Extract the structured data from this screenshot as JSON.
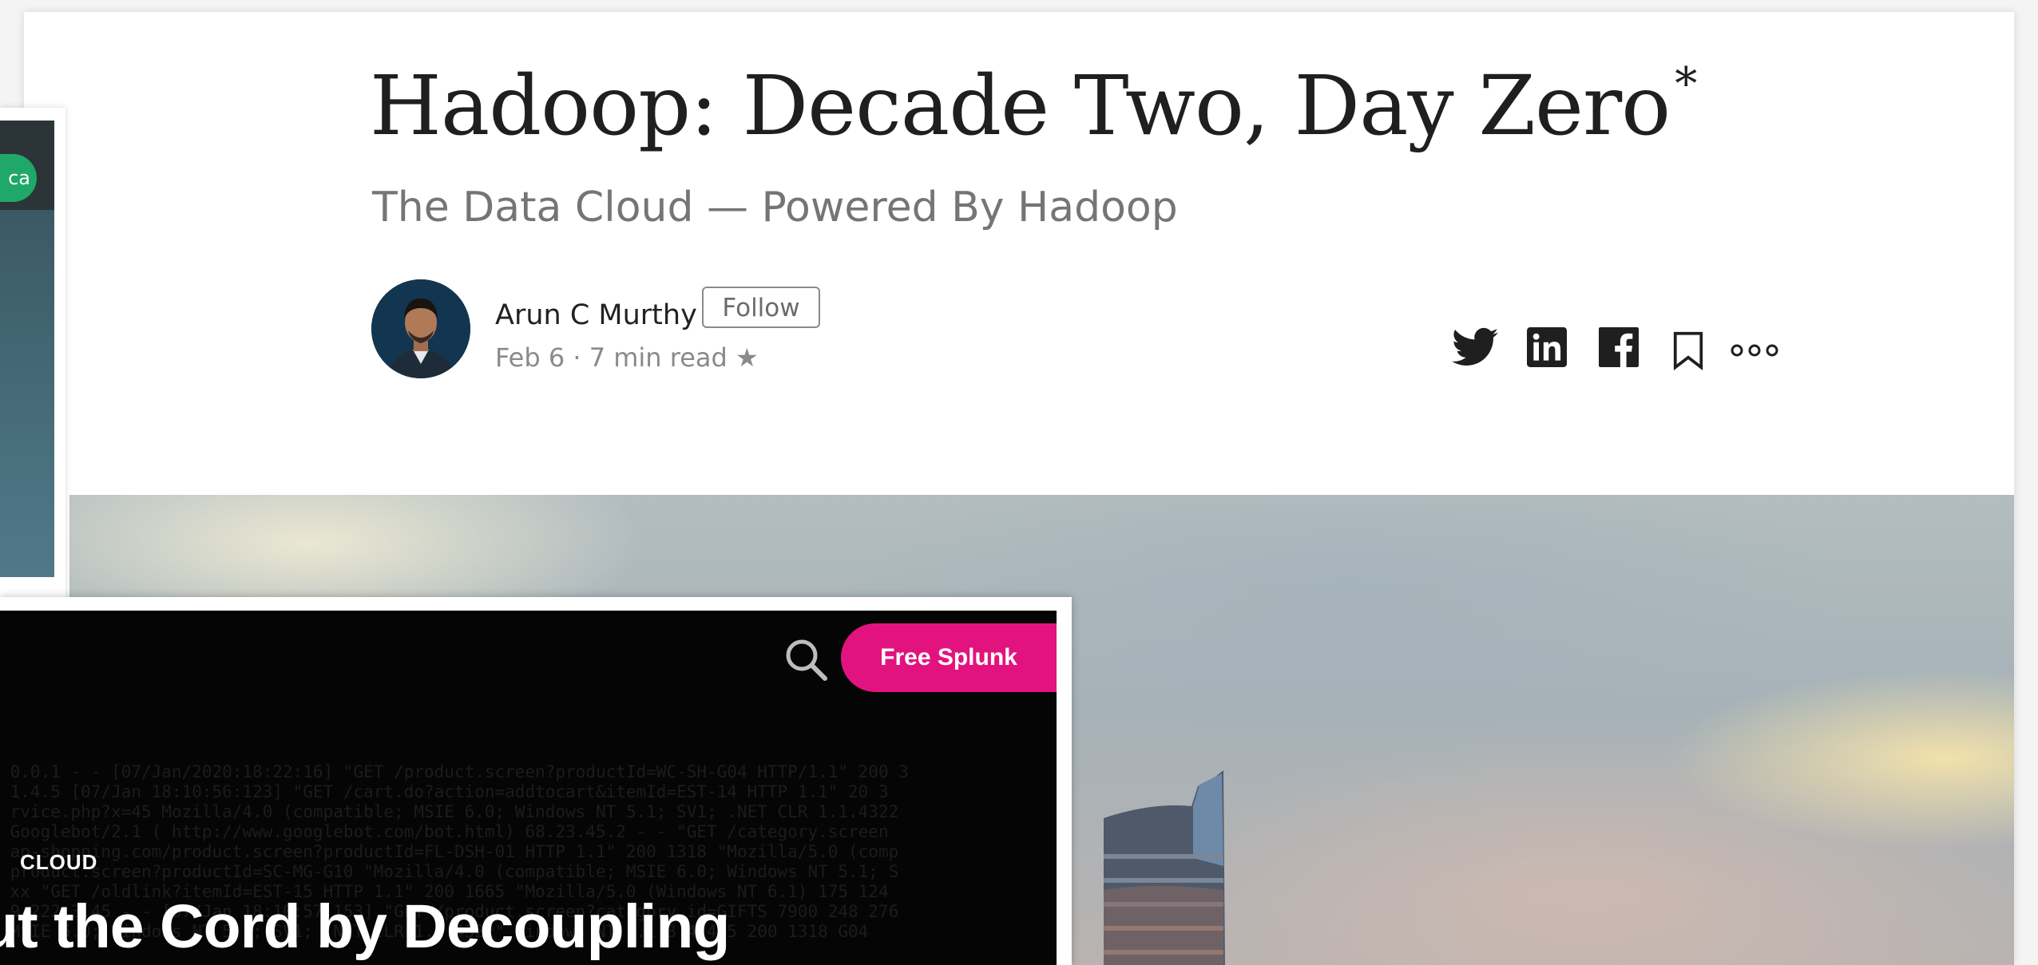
{
  "article": {
    "title": "Hadoop: Decade Two, Day Zero",
    "title_mark": "*",
    "subtitle": "The Data Cloud — Powered By Hadoop",
    "author": {
      "name": "Arun C Murthy",
      "follow_label": "Follow",
      "meta": "Feb 6 · 7 min read ★"
    },
    "share_icons": [
      "twitter-icon",
      "linkedin-icon",
      "facebook-icon",
      "bookmark-icon",
      "more-icon"
    ]
  },
  "side_window": {
    "pill_label": "ca"
  },
  "splunk": {
    "cta_label": "Free Splunk",
    "category": "CLOUD",
    "headline": "ut the Cord by Decoupling",
    "brand_color": "#e2137f"
  },
  "colors": {
    "title_text": "#1f1f1f",
    "subtitle_text": "#757575",
    "side_pill": "#1fa86a",
    "splunk_bg": "#050505"
  }
}
